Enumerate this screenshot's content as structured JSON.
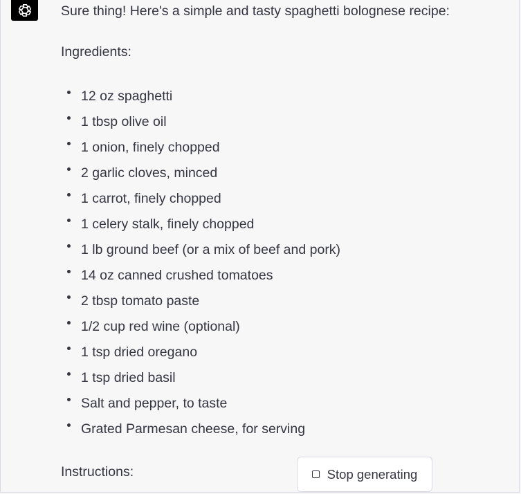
{
  "assistant": {
    "avatar_icon": "openai-logo-icon",
    "avatar_bg": "#000000"
  },
  "message": {
    "intro": "Sure thing! Here's a simple and tasty spaghetti bolognese recipe:",
    "ingredients_heading": "Ingredients:",
    "ingredients": [
      "12 oz spaghetti",
      "1 tbsp olive oil",
      "1 onion, finely chopped",
      "2 garlic cloves, minced",
      "1 carrot, finely chopped",
      "1 celery stalk, finely chopped",
      "1 lb ground beef (or a mix of beef and pork)",
      "14 oz canned crushed tomatoes",
      "2 tbsp tomato paste",
      "1/2 cup red wine (optional)",
      "1 tsp dried oregano",
      "1 tsp dried basil",
      "Salt and pepper, to taste",
      "Grated Parmesan cheese, for serving"
    ],
    "instructions_heading": "Instructions:"
  },
  "controls": {
    "stop_label": "Stop generating",
    "stop_icon": "stop-square-icon"
  }
}
